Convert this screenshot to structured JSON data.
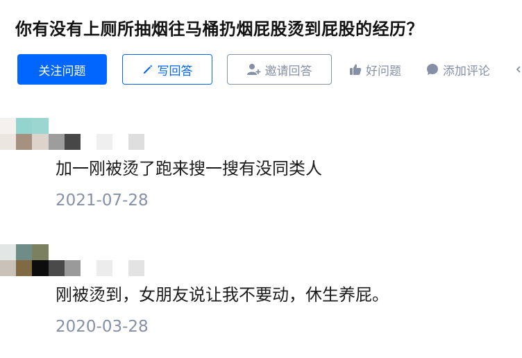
{
  "question": {
    "title": "你有没有上厕所抽烟往马桶扔烟屁股烫到屁股的经历？"
  },
  "actions": {
    "follow_label": "关注问题",
    "answer_label": "写回答",
    "invite_label": "邀请回答",
    "good_question_label": "好问题",
    "add_comment_label": "添加评论"
  },
  "colors": {
    "brand": "#0066ff",
    "muted": "#8590a6"
  },
  "icons": {
    "answer": "pencil-icon",
    "invite": "add-user-icon",
    "good_question": "thumbs-up-icon",
    "add_comment": "comment-bubble-icon",
    "more": "chevron-left-icon"
  },
  "comments": [
    {
      "text": "加一刚被烫了跑来搜一搜有没同类人",
      "date": "2021-07-28"
    },
    {
      "text": "刚被烫到，女朋友说让我不要动，休生养屁。",
      "date": "2020-03-28"
    }
  ]
}
